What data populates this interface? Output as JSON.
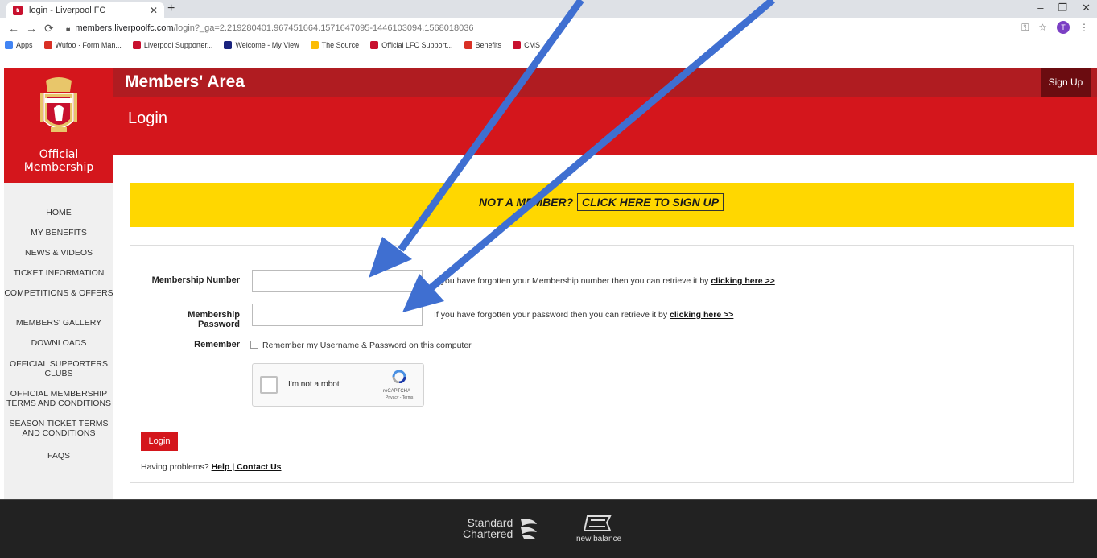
{
  "browser": {
    "tab_title": "login - Liverpool FC",
    "url_host": "members.liverpoolfc.com",
    "url_path": "/login?_ga=2.219280401.967451664.1571647095-1446103094.1568018036",
    "avatar_letter": "T",
    "bookmarks": [
      {
        "label": "Apps",
        "color": "#4285f4"
      },
      {
        "label": "Wufoo · Form Man...",
        "color": "#d93025"
      },
      {
        "label": "Liverpool Supporter...",
        "color": "#c8102e"
      },
      {
        "label": "Welcome - My View",
        "color": "#1a237e"
      },
      {
        "label": "The Source",
        "color": "#fbbc04"
      },
      {
        "label": "Official LFC Support...",
        "color": "#c8102e"
      },
      {
        "label": "Benefits",
        "color": "#d93025"
      },
      {
        "label": "CMS",
        "color": "#c8102e"
      }
    ]
  },
  "logo": {
    "line1": "Official",
    "line2": "Membership"
  },
  "nav": [
    "HOME",
    "MY BENEFITS",
    "NEWS & VIDEOS",
    "TICKET INFORMATION",
    "COMPETITIONS & OFFERS",
    "MEMBERS' GALLERY",
    "DOWNLOADS",
    "OFFICIAL SUPPORTERS CLUBS",
    "OFFICIAL MEMBERSHIP TERMS AND CONDITIONS",
    "SEASON TICKET TERMS AND CONDITIONS",
    "FAQS"
  ],
  "header": {
    "members_title": "Members' Area",
    "signup_label": "Sign Up",
    "login_title": "Login"
  },
  "banner": {
    "text": "NOT A MEMBER?",
    "link": "CLICK HERE TO SIGN UP"
  },
  "form": {
    "number_label": "Membership Number",
    "number_value": "",
    "number_help": "If you have forgotten your Membership number then you can retrieve it by",
    "password_label": "Membership Password",
    "password_value": "",
    "password_help": "If you have forgotten your password then you can retrieve it by",
    "help_link": "clicking here >>",
    "remember_label": "Remember",
    "remember_text": "Remember my Username & Password on this computer",
    "remember_checked": false,
    "captcha_text": "I'm not a robot",
    "captcha_brand": "reCAPTCHA",
    "captcha_terms": "Privacy - Terms",
    "login_button": "Login",
    "problems_text": "Having problems?",
    "problems_link": "Help | Contact Us"
  },
  "footer": {
    "sponsor1_line1": "Standard",
    "sponsor1_line2": "Chartered",
    "sponsor2": "new balance"
  },
  "colors": {
    "lfc_red": "#d4161c",
    "header_dark_red": "#b01c21",
    "banner_yellow": "#ffd700",
    "arrow_blue": "#3f6fd1"
  }
}
